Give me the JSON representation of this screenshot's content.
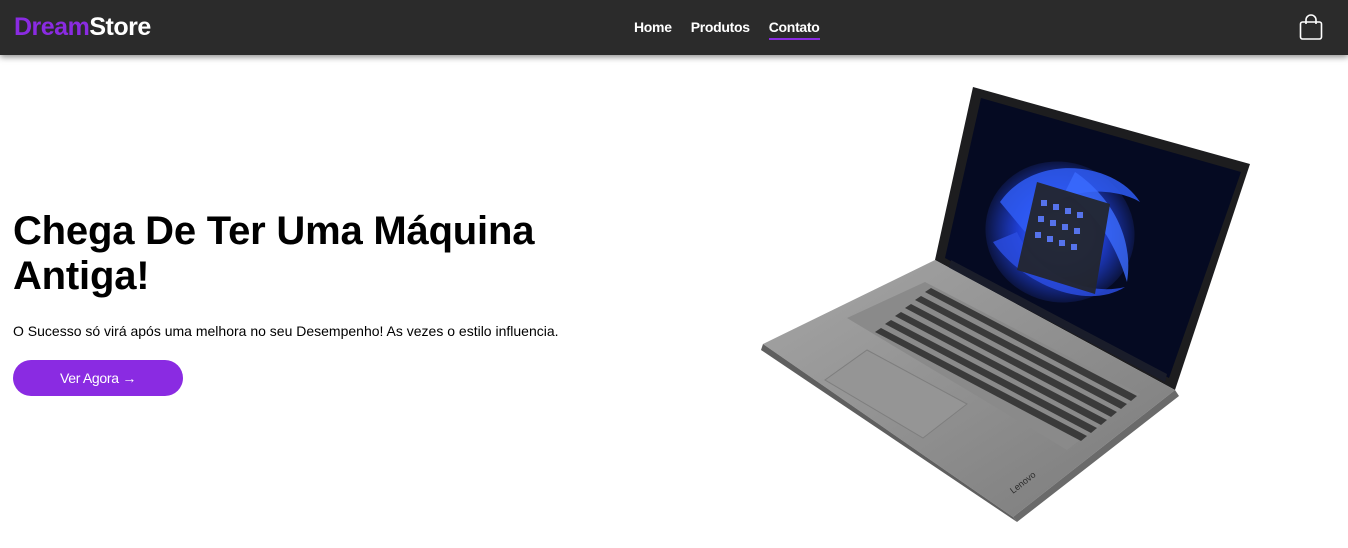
{
  "brand": {
    "part1": "Dream",
    "part2": "Store",
    "primary_color": "#8a2be2"
  },
  "nav": {
    "items": [
      {
        "label": "Home",
        "active": false
      },
      {
        "label": "Produtos",
        "active": false
      },
      {
        "label": "Contato",
        "active": true
      }
    ]
  },
  "cart": {
    "icon": "shopping-bag-icon"
  },
  "hero": {
    "title": "Chega De Ter Uma Máquina Antiga!",
    "subtitle": "O Sucesso só virá após uma melhora no seu Desempenho! As vezes o estilo influencia.",
    "cta_label": "Ver Agora →"
  },
  "product_image": {
    "brand_label": "Lenovo"
  }
}
